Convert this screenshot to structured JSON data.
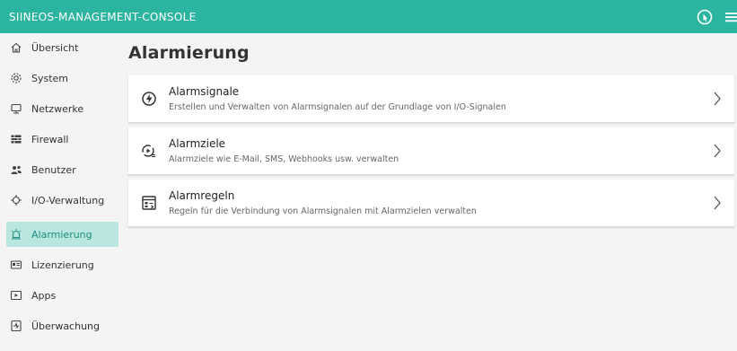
{
  "header": {
    "title": "SIINEOS-MANAGEMENT-CONSOLE",
    "help_icon": "help-touch-icon",
    "menu_icon": "hamburger-menu-icon",
    "bg_color": "#2bb5a0"
  },
  "sidebar": {
    "items": [
      {
        "label": "Übersicht",
        "icon": "home-icon"
      },
      {
        "label": "System",
        "icon": "gear-icon"
      },
      {
        "label": "Netzwerke",
        "icon": "network-icon"
      },
      {
        "label": "Firewall",
        "icon": "firewall-icon"
      },
      {
        "label": "Benutzer",
        "icon": "users-icon"
      },
      {
        "label": "I/O-Verwaltung",
        "icon": "io-icon"
      },
      {
        "label": "Alarmierung",
        "icon": "alarm-icon",
        "active": true
      },
      {
        "label": "Lizenzierung",
        "icon": "license-icon"
      },
      {
        "label": "Apps",
        "icon": "apps-icon"
      },
      {
        "label": "Überwachung",
        "icon": "monitoring-icon"
      }
    ],
    "active_color": "#b9e6df"
  },
  "main": {
    "title": "Alarmierung",
    "cards": [
      {
        "title": "Alarmsignale",
        "description": "Erstellen und Verwalten von Alarmsignalen auf der Grundlage von I/O-Signalen",
        "icon": "lightning-circle-icon"
      },
      {
        "title": "Alarmziele",
        "description": "Alarmziele wie E-Mail, SMS, Webhooks usw. verwalten",
        "icon": "target-list-icon"
      },
      {
        "title": "Alarmregeln",
        "description": "Regeln für die Verbindung von Alarmsignalen mit Alarmzielen verwalten",
        "icon": "rules-icon"
      }
    ]
  }
}
